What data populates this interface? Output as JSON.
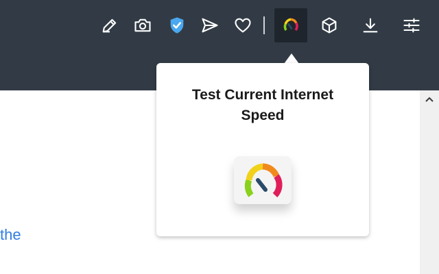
{
  "toolbar": {
    "buttons": [
      {
        "name": "edit",
        "icon": "pen-icon"
      },
      {
        "name": "screenshot",
        "icon": "camera-icon"
      },
      {
        "name": "shield",
        "icon": "shield-check-icon"
      },
      {
        "name": "send",
        "icon": "send-icon"
      },
      {
        "name": "favorites",
        "icon": "heart-icon"
      },
      {
        "name": "speed-test",
        "icon": "speedometer-icon"
      },
      {
        "name": "extensions",
        "icon": "cube-icon"
      },
      {
        "name": "downloads",
        "icon": "download-icon"
      },
      {
        "name": "settings",
        "icon": "sliders-icon"
      }
    ]
  },
  "popup": {
    "title": "Test Current Internet Speed",
    "icon": "speedometer-icon"
  },
  "content": {
    "link_text": "the"
  },
  "colors": {
    "toolbar_bg": "#323b45",
    "icon_color": "#ffffff",
    "shield_color": "#4aa8f0",
    "link_color": "#2f7de1"
  }
}
